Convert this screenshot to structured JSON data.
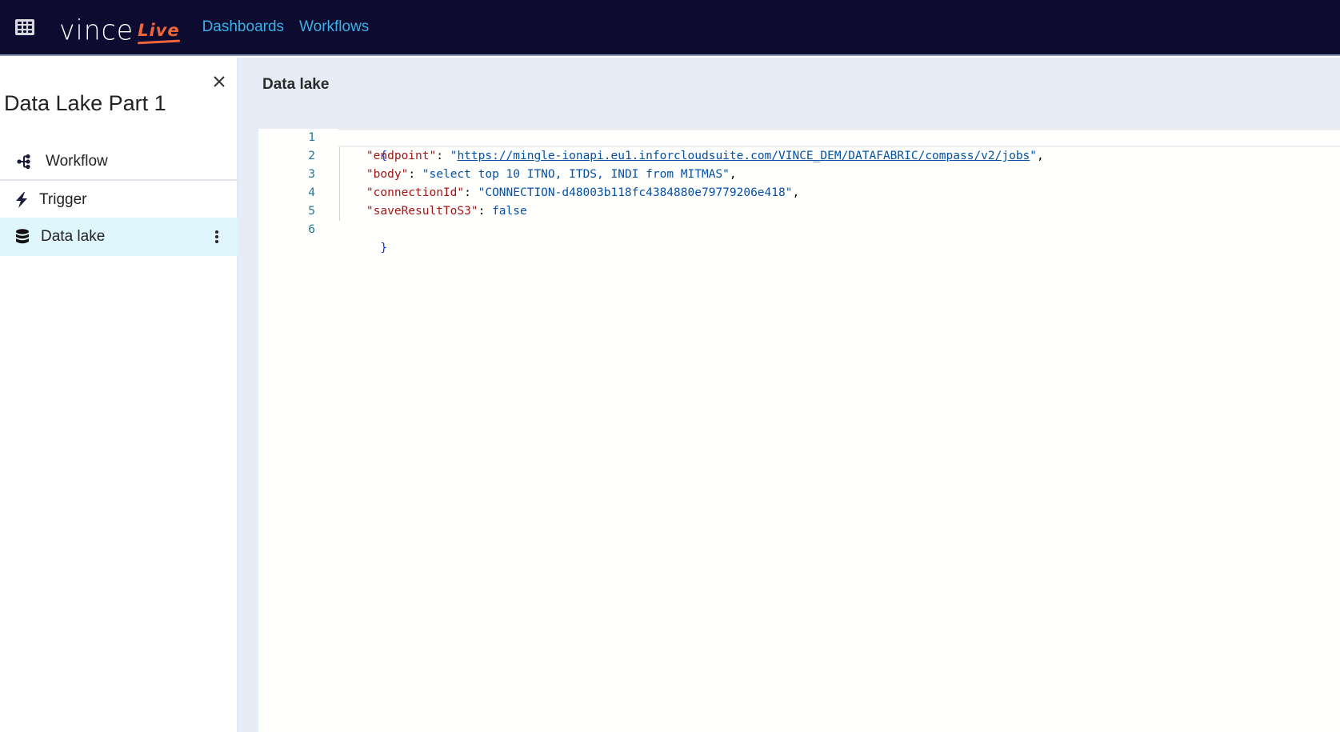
{
  "topbar": {
    "apps_icon": "grid-icon",
    "logo_main": "vince",
    "logo_accent": "LIVE",
    "nav": [
      {
        "label": "Dashboards"
      },
      {
        "label": "Workflows"
      }
    ],
    "colors": {
      "background": "#0e0b30",
      "nav_link": "#3ab1e8",
      "logo_accent": "#f0653a"
    }
  },
  "sidebar": {
    "title": "Data Lake Part 1",
    "close_icon": "close-icon",
    "items": [
      {
        "label": "Workflow",
        "icon": "workflow-tree-icon",
        "selected": false
      },
      {
        "label": "Trigger",
        "icon": "lightning-bolt-icon",
        "selected": false
      },
      {
        "label": "Data lake",
        "icon": "database-icon",
        "selected": true,
        "menu_icon": "kebab-menu-icon"
      }
    ],
    "selected_color": "#e0f6fd"
  },
  "main": {
    "title": "Data lake",
    "editor": {
      "line_numbers": [
        "1",
        "2",
        "3",
        "4",
        "5",
        "6"
      ],
      "lines": {
        "open_brace": "{",
        "close_brace": "}",
        "endpoint_key": "\"endpoint\"",
        "endpoint_value": "https://mingle-ionapi.eu1.inforcloudsuite.com/VINCE_DEM/DATAFABRIC/compass/v2/jobs",
        "body_key": "\"body\"",
        "body_value": "\"select top 10 ITNO, ITDS, INDI from MITMAS\"",
        "connection_key": "\"connectionId\"",
        "connection_value": "\"CONNECTION-d48003b118fc4384880e79779206e418\"",
        "save_key": "\"saveResultToS3\"",
        "save_value": "false",
        "colon": ": ",
        "comma": ",",
        "quote": "\""
      }
    }
  }
}
